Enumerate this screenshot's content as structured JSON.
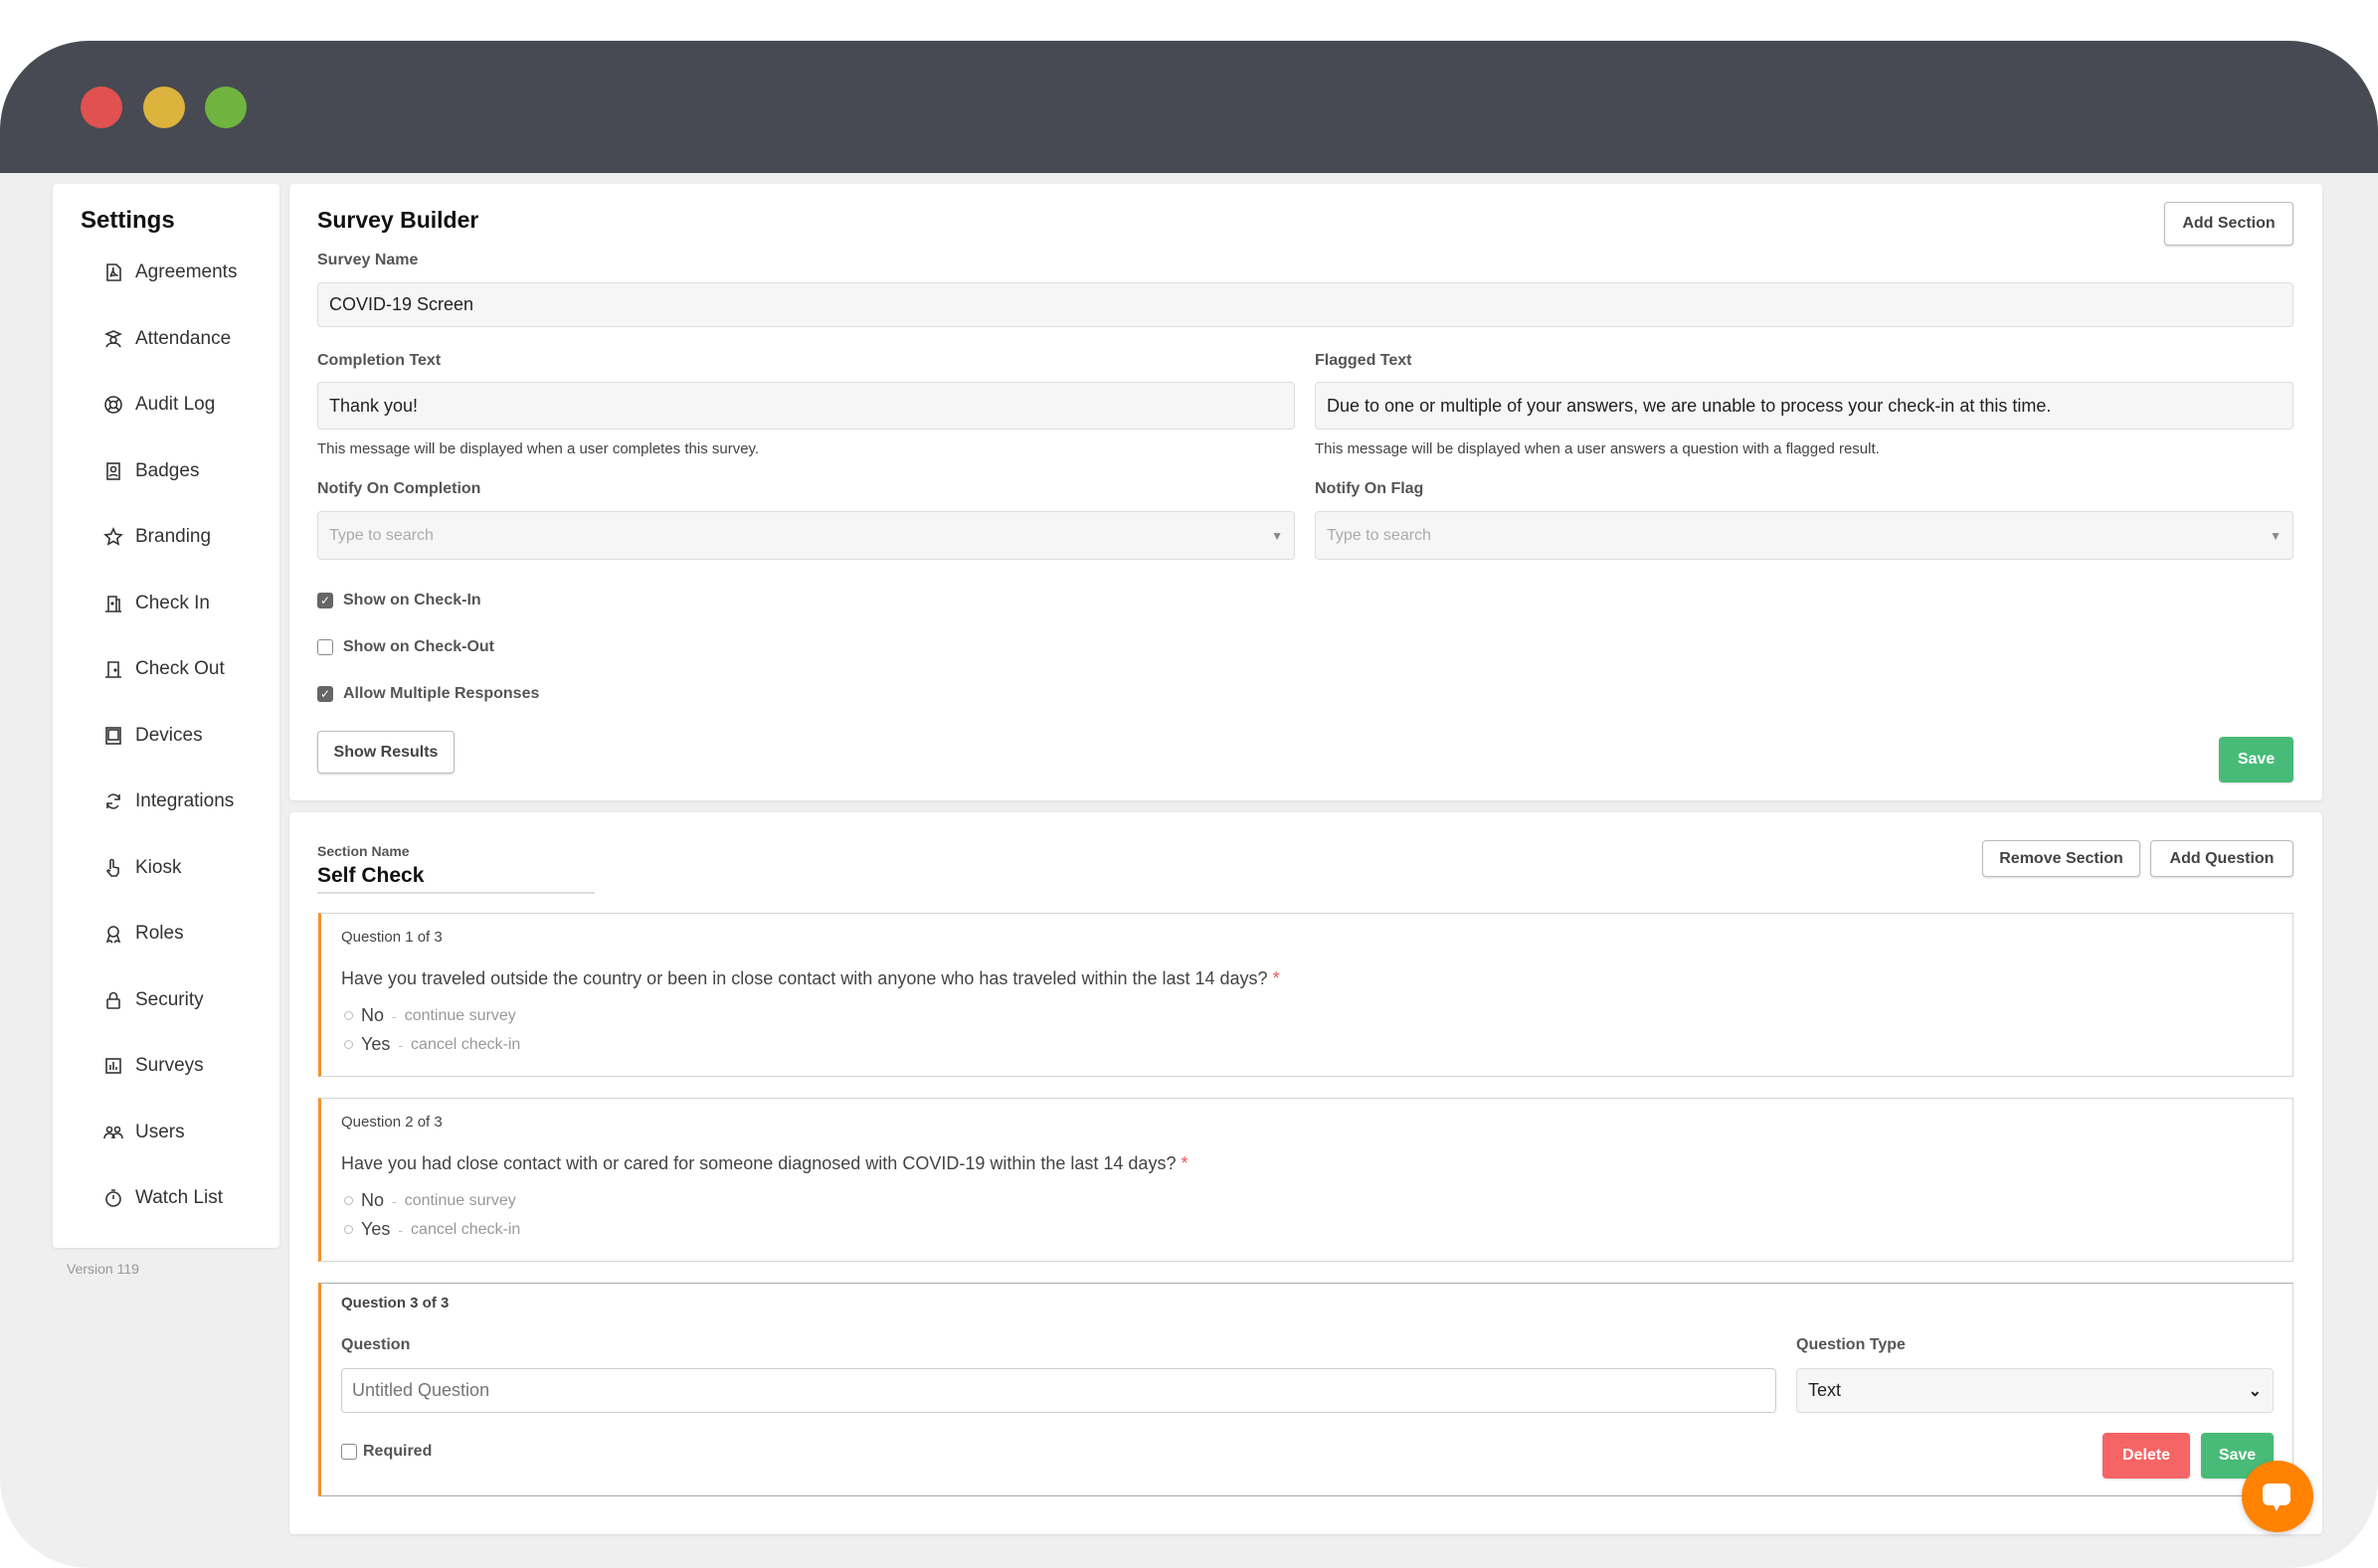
{
  "colors": {
    "accent": "#f6902a",
    "save": "#48bb78",
    "delete": "#f56565",
    "titlebar": "#474a52",
    "chat": "#ff8200"
  },
  "sidebar": {
    "title": "Settings",
    "items": [
      {
        "label": "Agreements",
        "icon": "file-pdf-icon"
      },
      {
        "label": "Attendance",
        "icon": "attendance-icon"
      },
      {
        "label": "Audit Log",
        "icon": "lifebuoy-icon"
      },
      {
        "label": "Badges",
        "icon": "badge-icon"
      },
      {
        "label": "Branding",
        "icon": "star-icon"
      },
      {
        "label": "Check In",
        "icon": "door-in-icon"
      },
      {
        "label": "Check Out",
        "icon": "door-out-icon"
      },
      {
        "label": "Devices",
        "icon": "tablet-icon"
      },
      {
        "label": "Integrations",
        "icon": "sync-icon"
      },
      {
        "label": "Kiosk",
        "icon": "pointer-icon"
      },
      {
        "label": "Roles",
        "icon": "award-icon"
      },
      {
        "label": "Security",
        "icon": "lock-icon"
      },
      {
        "label": "Surveys",
        "icon": "chart-icon"
      },
      {
        "label": "Users",
        "icon": "users-icon"
      },
      {
        "label": "Watch List",
        "icon": "stopwatch-icon"
      }
    ],
    "version": "Version 119"
  },
  "builder": {
    "title": "Survey Builder",
    "add_section": "Add Section",
    "survey_name_label": "Survey Name",
    "survey_name": "COVID-19 Screen",
    "completion_label": "Completion Text",
    "completion_value": "Thank you!",
    "completion_help": "This message will be displayed when a user completes this survey.",
    "flagged_label": "Flagged Text",
    "flagged_value": "Due to one or multiple of your answers, we are unable to process your check-in at this time.",
    "flagged_help": "This message will be displayed when a user answers a question with a flagged result.",
    "notify_completion_label": "Notify On Completion",
    "notify_flag_label": "Notify On Flag",
    "search_placeholder": "Type to search",
    "checkboxes": [
      {
        "label": "Show on Check-In",
        "checked": true
      },
      {
        "label": "Show on Check-Out",
        "checked": false
      },
      {
        "label": "Allow Multiple Responses",
        "checked": true
      }
    ],
    "show_results": "Show Results",
    "save": "Save"
  },
  "section": {
    "name_label": "Section Name",
    "name": "Self Check",
    "remove": "Remove Section",
    "add_question": "Add Question",
    "questions": [
      {
        "counter": "Question 1 of 3",
        "text": "Have you traveled outside the country or been in close contact with anyone who has traveled within the last 14 days?",
        "required_mark": "*",
        "options": [
          {
            "label": "No",
            "sep": "-",
            "action": "continue survey"
          },
          {
            "label": "Yes",
            "sep": "-",
            "action": "cancel check-in"
          }
        ]
      },
      {
        "counter": "Question 2 of 3",
        "text": "Have you had close contact with or cared for someone diagnosed with COVID-19 within the last 14 days?",
        "required_mark": "*",
        "options": [
          {
            "label": "No",
            "sep": "-",
            "action": "continue survey"
          },
          {
            "label": "Yes",
            "sep": "-",
            "action": "cancel check-in"
          }
        ]
      }
    ],
    "editor": {
      "counter": "Question 3 of 3",
      "question_label": "Question",
      "question_placeholder": "Untitled Question",
      "type_label": "Question Type",
      "type_value": "Text",
      "required_label": "Required",
      "required": false,
      "delete": "Delete",
      "save": "Save"
    }
  }
}
